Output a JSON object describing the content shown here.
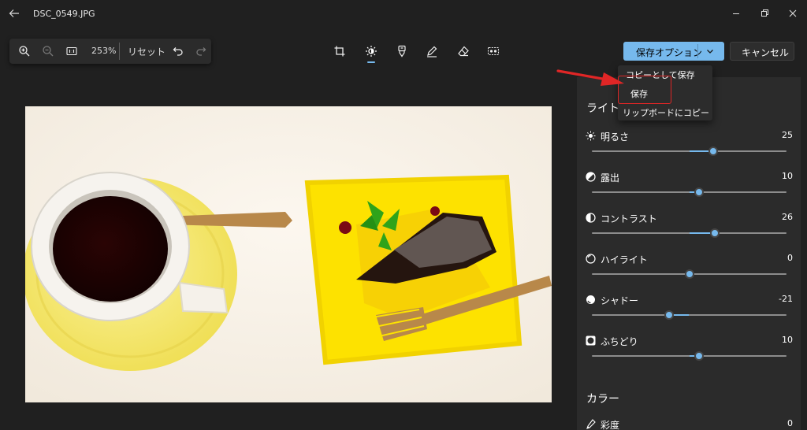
{
  "window": {
    "title": "DSC_0549.JPG"
  },
  "zoombar": {
    "zoom": "253%",
    "reset_label": "リセット"
  },
  "toolbar": {
    "tools": [
      "crop-icon",
      "adjust-icon",
      "filter-icon",
      "markup-icon",
      "erase-icon",
      "background-blur-icon"
    ],
    "active_tool": "adjust-icon"
  },
  "actions": {
    "save_options_label": "保存オプション",
    "cancel_label": "キャンセル"
  },
  "menu": {
    "items": [
      "コピーとして保存",
      "保存",
      "リップボードにコピー"
    ],
    "highlighted_item": "保存"
  },
  "panel": {
    "section_light": "ライト",
    "section_color": "カラー",
    "adjustments": [
      {
        "label": "明るさ",
        "value": "25",
        "icon": "brightness-icon",
        "fraction": 0.625
      },
      {
        "label": "露出",
        "value": "10",
        "icon": "exposure-icon",
        "fraction": 0.55
      },
      {
        "label": "コントラスト",
        "value": "26",
        "icon": "contrast-icon",
        "fraction": 0.63
      },
      {
        "label": "ハイライト",
        "value": "0",
        "icon": "highlights-icon",
        "fraction": 0.5
      },
      {
        "label": "シャドー",
        "value": "-21",
        "icon": "shadows-icon",
        "fraction": 0.395
      },
      {
        "label": "ふちどり",
        "value": "10",
        "icon": "vignette-icon",
        "fraction": 0.55
      }
    ],
    "saturation": {
      "label": "彩度",
      "value": "0",
      "icon": "saturation-icon"
    }
  },
  "colors": {
    "accent": "#76b9ed",
    "background": "#202020",
    "panel": "#2b2b2b",
    "annotation": "#e02626"
  }
}
